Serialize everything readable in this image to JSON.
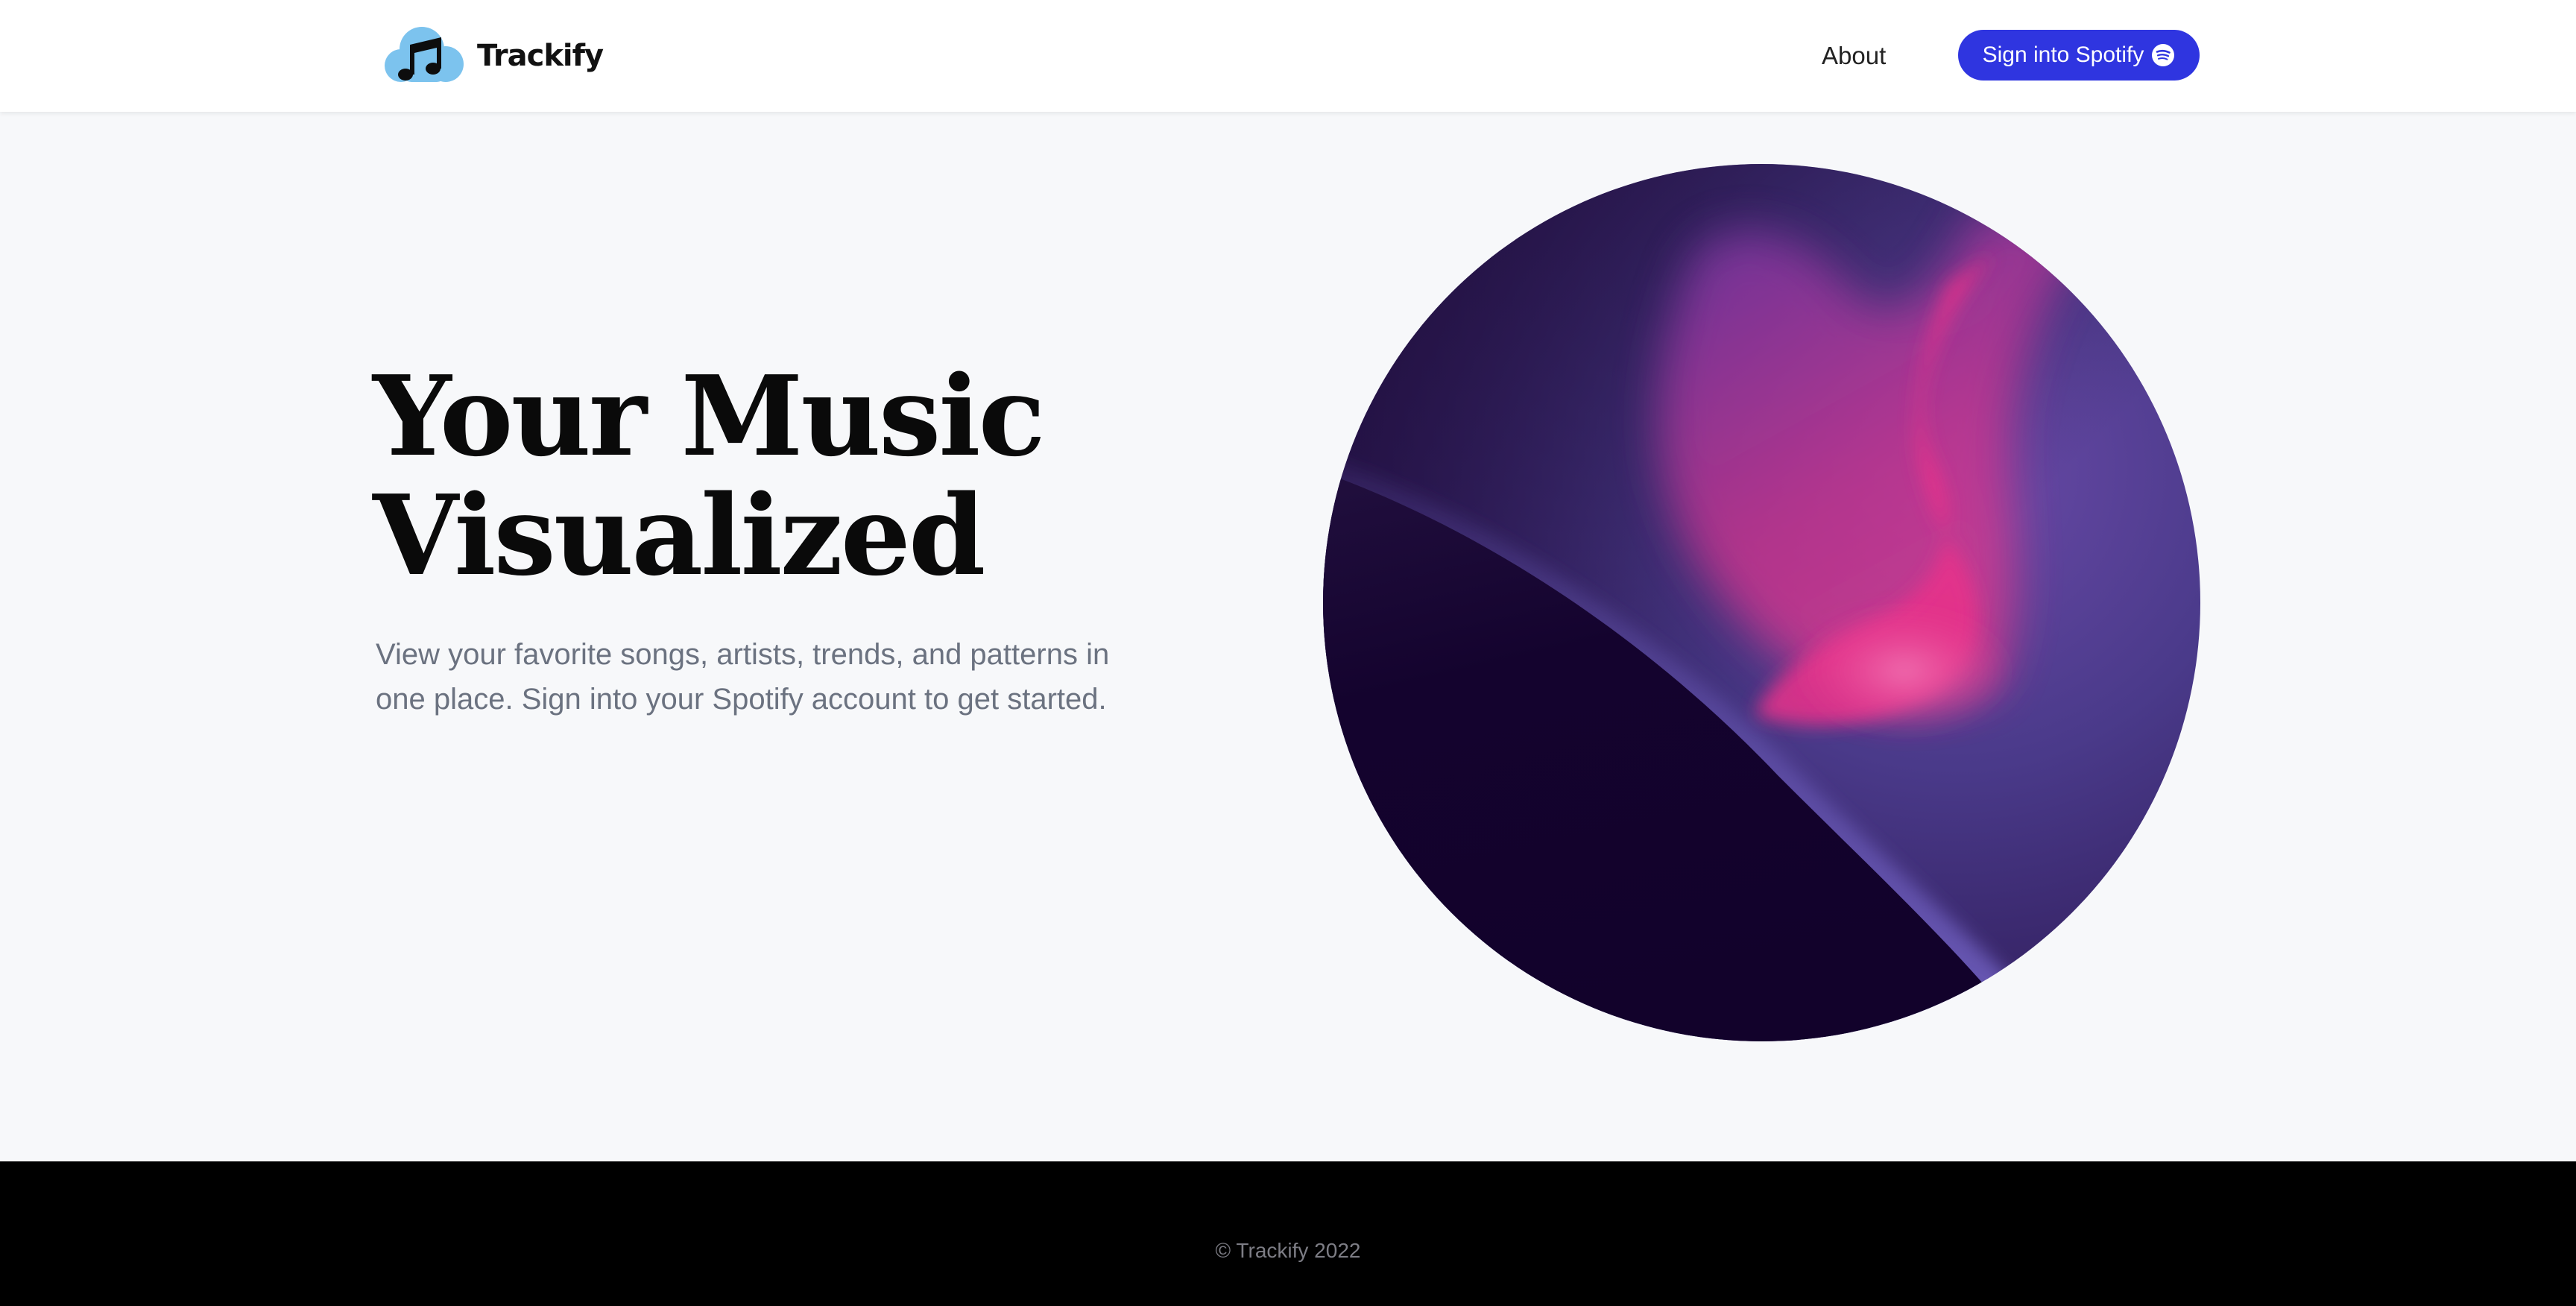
{
  "brand": {
    "name": "Trackify",
    "logo_icon": "cloud-music-note-icon",
    "logo_color": "#7cc3ee"
  },
  "nav": {
    "about_label": "About",
    "signin_label": "Sign into Spotify",
    "signin_icon": "spotify-icon",
    "signin_color": "#2f35e0"
  },
  "hero": {
    "title_line1": "Your Music",
    "title_line2": "Visualized",
    "subtitle": "View your favorite songs, artists, trends, and patterns in one place. Sign into your Spotify account to get started.",
    "art_colors": [
      "#1a0533",
      "#4a3a8a",
      "#e8338a"
    ]
  },
  "footer": {
    "copyright": "© Trackify 2022",
    "background": "#000000"
  }
}
